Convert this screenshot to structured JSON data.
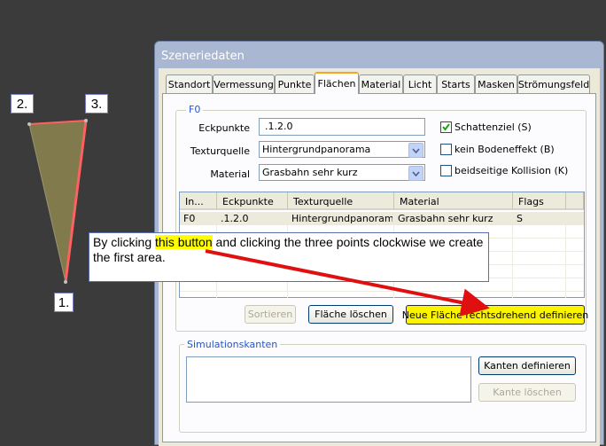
{
  "point_labels": {
    "p1": "1.",
    "p2": "2.",
    "p3": "3."
  },
  "window": {
    "title": "Szeneriedaten",
    "tabs": [
      "Standort",
      "Vermessung",
      "Punkte",
      "Flächen",
      "Material",
      "Licht",
      "Starts",
      "Masken",
      "Strömungsfeld"
    ],
    "active_tab": "Flächen"
  },
  "area_group": {
    "label": "F0",
    "eckpunkte_label": "Eckpunkte",
    "eckpunkte_value": ".1.2.0",
    "texturquelle_label": "Texturquelle",
    "texturquelle_value": "Hintergrundpanorama",
    "material_label": "Material",
    "material_value": "Grasbahn sehr kurz",
    "checkboxes": [
      {
        "label": "Schattenziel (S)",
        "checked": true
      },
      {
        "label": "kein Bodeneffekt (B)",
        "checked": false
      },
      {
        "label": "beidseitige Kollision (K)",
        "checked": false
      }
    ]
  },
  "table": {
    "headers": [
      "In...",
      "Eckpunkte",
      "Texturquelle",
      "Material",
      "Flags"
    ],
    "rows": [
      [
        "F0",
        ".1.2.0",
        "Hintergrundpanorama",
        "Grasbahn sehr kurz",
        "S"
      ]
    ]
  },
  "buttons": {
    "sortieren": "Sortieren",
    "flaeche_loeschen": "Fläche löschen",
    "neue_flaeche": "Neue Fläche rechtsdrehend definieren",
    "kanten_definieren": "Kanten definieren",
    "kante_loeschen": "Kante löschen"
  },
  "simulationskanten_label": "Simulationskanten",
  "callout": {
    "text_before": "By clicking ",
    "highlight": "this button",
    "text_after": " and clicking the three points clockwise we create the first area."
  },
  "colors": {
    "background": "#3b3b3b",
    "area_fill": "#807a4c",
    "edge_red": "#ff6060",
    "highlight_yellow": "#fcf300",
    "arrow_red": "#e01010"
  },
  "icons": {
    "checkmark": "✔",
    "combo_arrow": "chevron-down-icon"
  }
}
